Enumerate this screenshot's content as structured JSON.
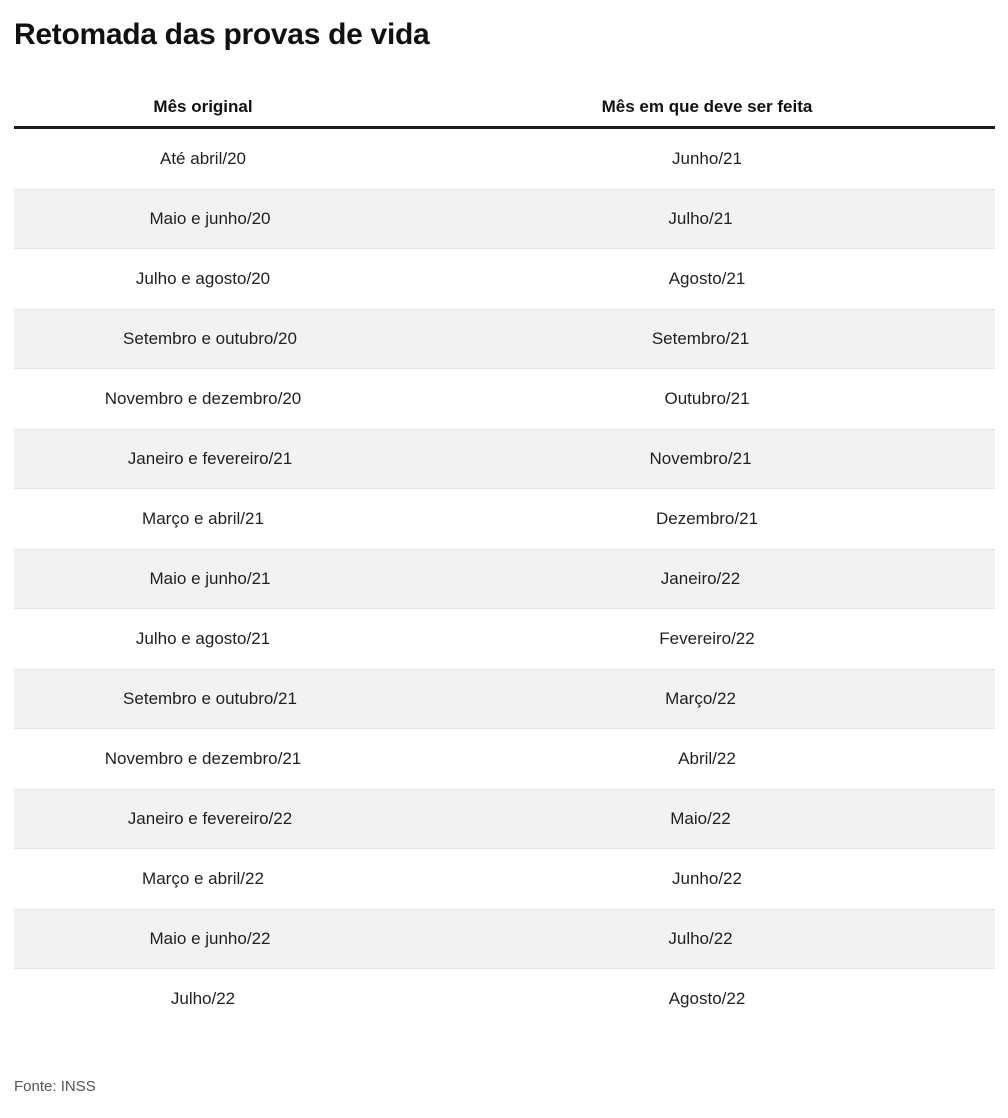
{
  "title": "Retomada das provas de vida",
  "table": {
    "headers": {
      "col1": "Mês original",
      "col2": "Mês em que deve ser feita"
    },
    "rows": [
      {
        "original": "Até abril/20",
        "new": "Junho/21"
      },
      {
        "original": "Maio e junho/20",
        "new": "Julho/21"
      },
      {
        "original": "Julho e agosto/20",
        "new": "Agosto/21"
      },
      {
        "original": "Setembro e outubro/20",
        "new": "Setembro/21"
      },
      {
        "original": "Novembro e dezembro/20",
        "new": "Outubro/21"
      },
      {
        "original": "Janeiro e fevereiro/21",
        "new": "Novembro/21"
      },
      {
        "original": "Março e abril/21",
        "new": "Dezembro/21"
      },
      {
        "original": "Maio e junho/21",
        "new": "Janeiro/22"
      },
      {
        "original": "Julho e agosto/21",
        "new": "Fevereiro/22"
      },
      {
        "original": "Setembro e outubro/21",
        "new": "Março/22"
      },
      {
        "original": "Novembro e dezembro/21",
        "new": "Abril/22"
      },
      {
        "original": "Janeiro e fevereiro/22",
        "new": "Maio/22"
      },
      {
        "original": "Março e abril/22",
        "new": "Junho/22"
      },
      {
        "original": "Maio e junho/22",
        "new": "Julho/22"
      },
      {
        "original": "Julho/22",
        "new": "Agosto/22"
      }
    ]
  },
  "source": "Fonte: INSS",
  "colors": {
    "shaded_row": "#f2f2f2",
    "header_rule": "#1b1b1b",
    "text": "#1f1f1f",
    "source_text": "#555555"
  }
}
